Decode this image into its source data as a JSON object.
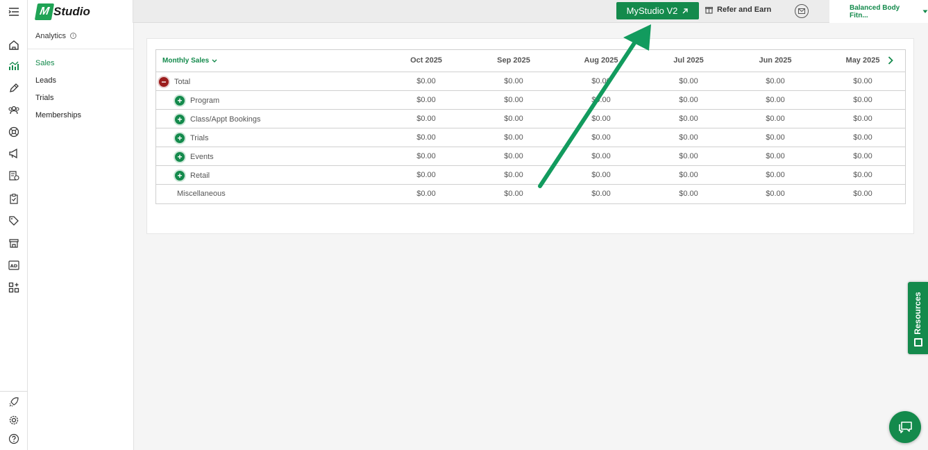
{
  "brand": {
    "logo_mark": "M",
    "logo_text": "Studio",
    "accent": "#148a4c"
  },
  "topbar": {
    "v2_label": "MyStudio V2",
    "refer_label": "Refer and Earn",
    "account_name": "Balanced Body Fitn..."
  },
  "subnav": {
    "title": "Analytics",
    "info": "i",
    "items": [
      {
        "label": "Sales",
        "active": true
      },
      {
        "label": "Leads"
      },
      {
        "label": "Trials"
      },
      {
        "label": "Memberships"
      }
    ]
  },
  "table": {
    "period_label": "Monthly Sales",
    "columns": [
      "Oct 2025",
      "Sep 2025",
      "Aug 2025",
      "Jul 2025",
      "Jun 2025",
      "May 2025"
    ],
    "rows": [
      {
        "label": "Total",
        "toggle": "−",
        "values": [
          "$0.00",
          "$0.00",
          "$0.00",
          "$0.00",
          "$0.00",
          "$0.00"
        ]
      },
      {
        "label": "Program",
        "toggle": "+",
        "values": [
          "$0.00",
          "$0.00",
          "$0.00",
          "$0.00",
          "$0.00",
          "$0.00"
        ]
      },
      {
        "label": "Class/Appt Bookings",
        "toggle": "+",
        "values": [
          "$0.00",
          "$0.00",
          "$0.00",
          "$0.00",
          "$0.00",
          "$0.00"
        ]
      },
      {
        "label": "Trials",
        "toggle": "+",
        "values": [
          "$0.00",
          "$0.00",
          "$0.00",
          "$0.00",
          "$0.00",
          "$0.00"
        ]
      },
      {
        "label": "Events",
        "toggle": "+",
        "values": [
          "$0.00",
          "$0.00",
          "$0.00",
          "$0.00",
          "$0.00",
          "$0.00"
        ]
      },
      {
        "label": "Retail",
        "toggle": "+",
        "values": [
          "$0.00",
          "$0.00",
          "$0.00",
          "$0.00",
          "$0.00",
          "$0.00"
        ]
      },
      {
        "label": "Miscellaneous",
        "values": [
          "$0.00",
          "$0.00",
          "$0.00",
          "$0.00",
          "$0.00",
          "$0.00"
        ]
      }
    ]
  },
  "resources": {
    "label": "Resources"
  },
  "icons": {
    "rail": [
      "home-icon",
      "analytics-icon",
      "pen-icon",
      "users-icon",
      "support-icon",
      "megaphone-icon",
      "report-icon",
      "checklist-icon",
      "tag-icon",
      "store-icon",
      "ad-icon",
      "apps-icon"
    ],
    "rail_bottom": [
      "rocket-icon",
      "gear-icon",
      "help-icon"
    ]
  }
}
